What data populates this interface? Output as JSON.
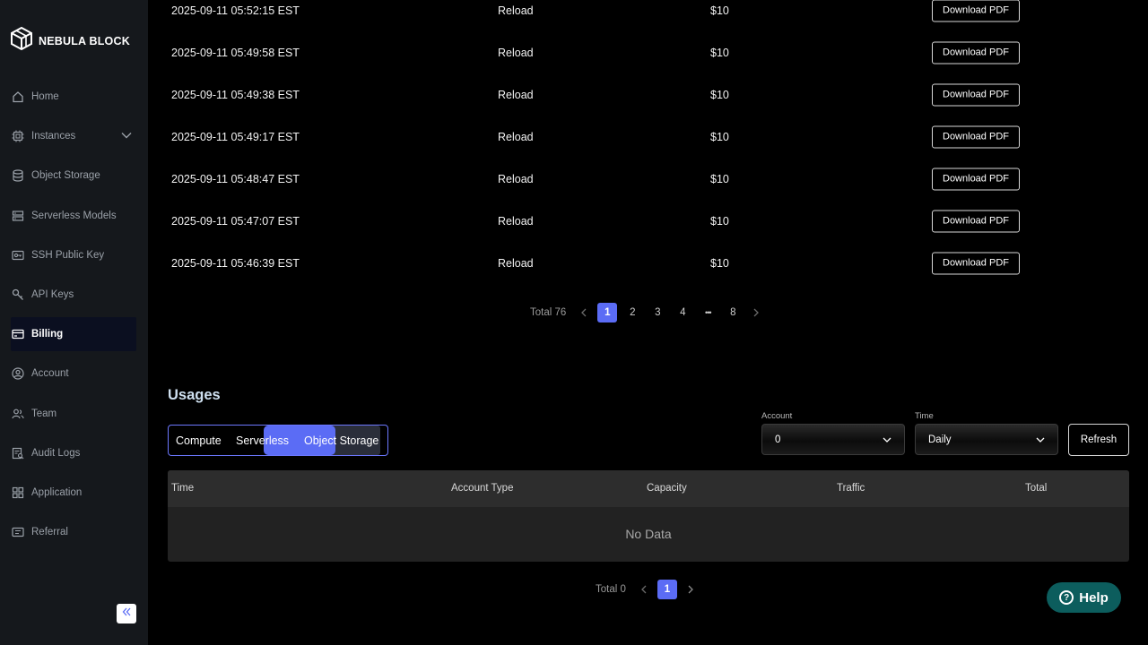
{
  "brand": {
    "name": "NEBULA BLOCK"
  },
  "sidebar": {
    "items": [
      {
        "label": "Home",
        "icon": "home-icon"
      },
      {
        "label": "Instances",
        "icon": "chip-icon"
      },
      {
        "label": "Object Storage",
        "icon": "database-icon"
      },
      {
        "label": "Serverless Models",
        "icon": "server-icon"
      },
      {
        "label": "SSH Public Key",
        "icon": "key-card-icon"
      },
      {
        "label": "API Keys",
        "icon": "key-icon"
      },
      {
        "label": "Billing",
        "icon": "credit-card-icon",
        "active": true
      },
      {
        "label": "Account",
        "icon": "user-circle-icon"
      },
      {
        "label": "Team",
        "icon": "team-icon"
      },
      {
        "label": "Audit Logs",
        "icon": "audit-icon"
      },
      {
        "label": "Application",
        "icon": "apps-icon"
      },
      {
        "label": "Referral",
        "icon": "referral-icon"
      }
    ]
  },
  "transactions": {
    "rows": [
      {
        "time": "2025-09-11 05:52:15 EST",
        "type": "Reload",
        "amount": "$10",
        "action": "Download PDF"
      },
      {
        "time": "2025-09-11 05:49:58 EST",
        "type": "Reload",
        "amount": "$10",
        "action": "Download PDF"
      },
      {
        "time": "2025-09-11 05:49:38 EST",
        "type": "Reload",
        "amount": "$10",
        "action": "Download PDF"
      },
      {
        "time": "2025-09-11 05:49:17 EST",
        "type": "Reload",
        "amount": "$10",
        "action": "Download PDF"
      },
      {
        "time": "2025-09-11 05:48:47 EST",
        "type": "Reload",
        "amount": "$10",
        "action": "Download PDF"
      },
      {
        "time": "2025-09-11 05:47:07 EST",
        "type": "Reload",
        "amount": "$10",
        "action": "Download PDF"
      },
      {
        "time": "2025-09-11 05:46:39 EST",
        "type": "Reload",
        "amount": "$10",
        "action": "Download PDF"
      }
    ],
    "pagination": {
      "total": "Total 76",
      "pages": [
        "1",
        "2",
        "3",
        "4",
        "•••",
        "8"
      ],
      "current": "1"
    }
  },
  "usages": {
    "title": "Usages",
    "tabs": [
      "Compute",
      "Serverless",
      "Object Storage"
    ],
    "active_tab": "Object Storage",
    "account": {
      "label": "Account",
      "value": "0"
    },
    "time": {
      "label": "Time",
      "value": "Daily"
    },
    "refresh_label": "Refresh",
    "columns": [
      "Time",
      "Account Type",
      "Capacity",
      "Traffic",
      "Total"
    ],
    "empty_text": "No Data",
    "pagination": {
      "total": "Total 0",
      "current": "1"
    }
  },
  "help": {
    "label": "Help"
  },
  "colors": {
    "accent": "#5b6cf5",
    "sidebar_bg": "#15181c",
    "help_bg": "#0c5d5d"
  }
}
